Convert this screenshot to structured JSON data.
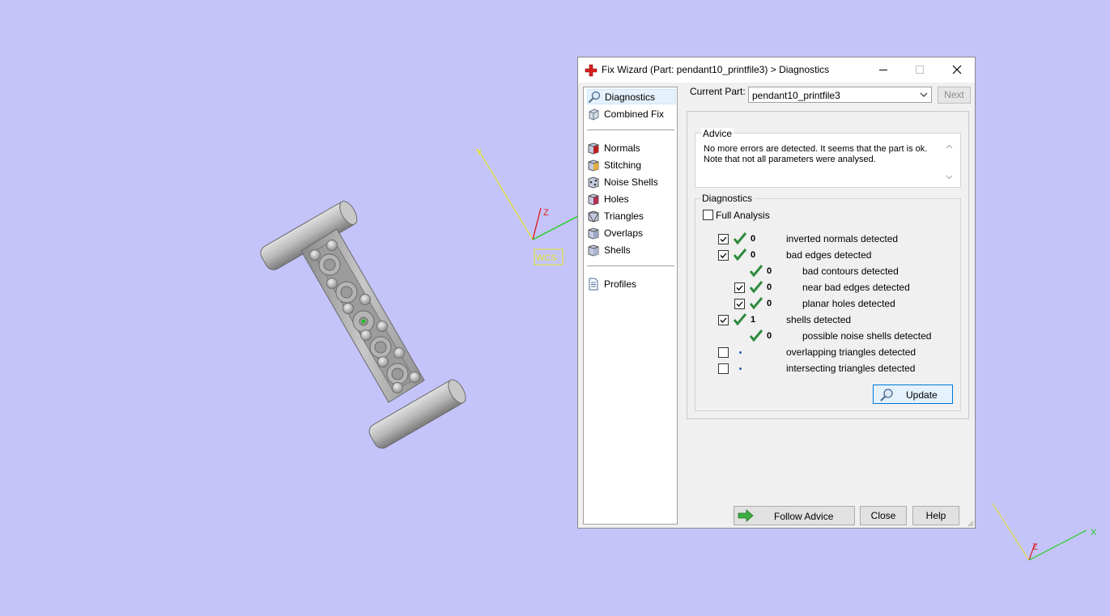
{
  "viewport": {
    "main_axes": {
      "y_label": "Y",
      "z_label": "Z",
      "wcs_label": "WCS"
    },
    "corner_axes": {
      "z_label": "Z",
      "x_label": "X"
    }
  },
  "dialog": {
    "title": "Fix Wizard (Part: pendant10_printfile3) > Diagnostics",
    "nav": {
      "top": [
        "Diagnostics",
        "Combined Fix"
      ],
      "tools": [
        "Normals",
        "Stitching",
        "Noise Shells",
        "Holes",
        "Triangles",
        "Overlaps",
        "Shells"
      ],
      "bottom": [
        "Profiles"
      ],
      "selected": "Diagnostics"
    },
    "current_part_label": "Current Part:",
    "current_part_value": "pendant10_printfile3",
    "next_label": "Next",
    "advice": {
      "caption": "Advice",
      "line1": "No more errors are detected. It seems that the part is ok.",
      "line2": "Note that not all parameters were analysed."
    },
    "diagnostics": {
      "caption": "Diagnostics",
      "full_analysis_label": "Full Analysis",
      "full_analysis_checked": false,
      "rows": [
        {
          "checked": true,
          "status": "ok",
          "count": "0",
          "label": "inverted normals detected"
        },
        {
          "checked": true,
          "status": "ok",
          "count": "0",
          "label": "bad edges detected"
        },
        {
          "checked": null,
          "status": "ok",
          "count": "0",
          "label": "bad contours detected"
        },
        {
          "checked": true,
          "status": "ok",
          "count": "0",
          "label": "near bad edges detected"
        },
        {
          "checked": true,
          "status": "ok",
          "count": "0",
          "label": "planar holes detected"
        },
        {
          "checked": true,
          "status": "ok",
          "count": "1",
          "label": "shells detected"
        },
        {
          "checked": null,
          "status": "ok",
          "count": "0",
          "label": "possible noise shells detected"
        },
        {
          "checked": false,
          "status": "pending",
          "count": "",
          "label": "overlapping triangles detected"
        },
        {
          "checked": false,
          "status": "pending",
          "count": "",
          "label": "intersecting triangles detected"
        }
      ],
      "update_label": "Update"
    },
    "buttons": {
      "follow_advice": "Follow Advice",
      "close": "Close",
      "help": "Help"
    }
  },
  "colors": {
    "background": "#c4c4fa",
    "check_green": "#2e8b3d",
    "axis_y": "#e8e820",
    "axis_z": "#e02020",
    "axis_x": "#20d020",
    "title_icon_red": "#d81e1e"
  }
}
